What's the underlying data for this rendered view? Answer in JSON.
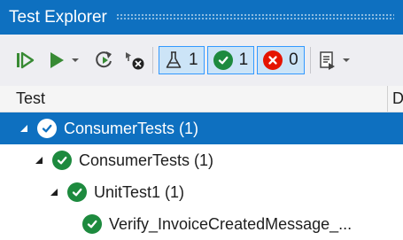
{
  "window": {
    "title": "Test Explorer"
  },
  "toolbar": {
    "run_all_icon": "run-all-icon",
    "run_icon": "run-icon",
    "repeat_icon": "repeat-last-run-icon",
    "cancel_icon": "cancel-run-icon",
    "playlist_icon": "playlist-icon",
    "filters": [
      {
        "name": "total",
        "icon": "flask-icon",
        "count": "1"
      },
      {
        "name": "passed",
        "icon": "passed-icon",
        "count": "1"
      },
      {
        "name": "failed",
        "icon": "failed-icon",
        "count": "0"
      }
    ]
  },
  "columns": {
    "test": "Test",
    "duration_partial": "D"
  },
  "tree": [
    {
      "label": "ConsumerTests (1)",
      "level": 0,
      "status": "passed",
      "expanded": true,
      "selected": true
    },
    {
      "label": "ConsumerTests (1)",
      "level": 1,
      "status": "passed",
      "expanded": true,
      "selected": false
    },
    {
      "label": "UnitTest1 (1)",
      "level": 2,
      "status": "passed",
      "expanded": true,
      "selected": false
    },
    {
      "label": "Verify_InvoiceCreatedMessage_...",
      "level": 3,
      "status": "passed",
      "expanded": false,
      "selected": false
    }
  ],
  "colors": {
    "accent": "#0e70c0",
    "passed": "#1d8a3e",
    "failed": "#e51400",
    "run": "#388a34",
    "filter_active_bg": "#cce4f7",
    "filter_active_border": "#3399ff"
  }
}
